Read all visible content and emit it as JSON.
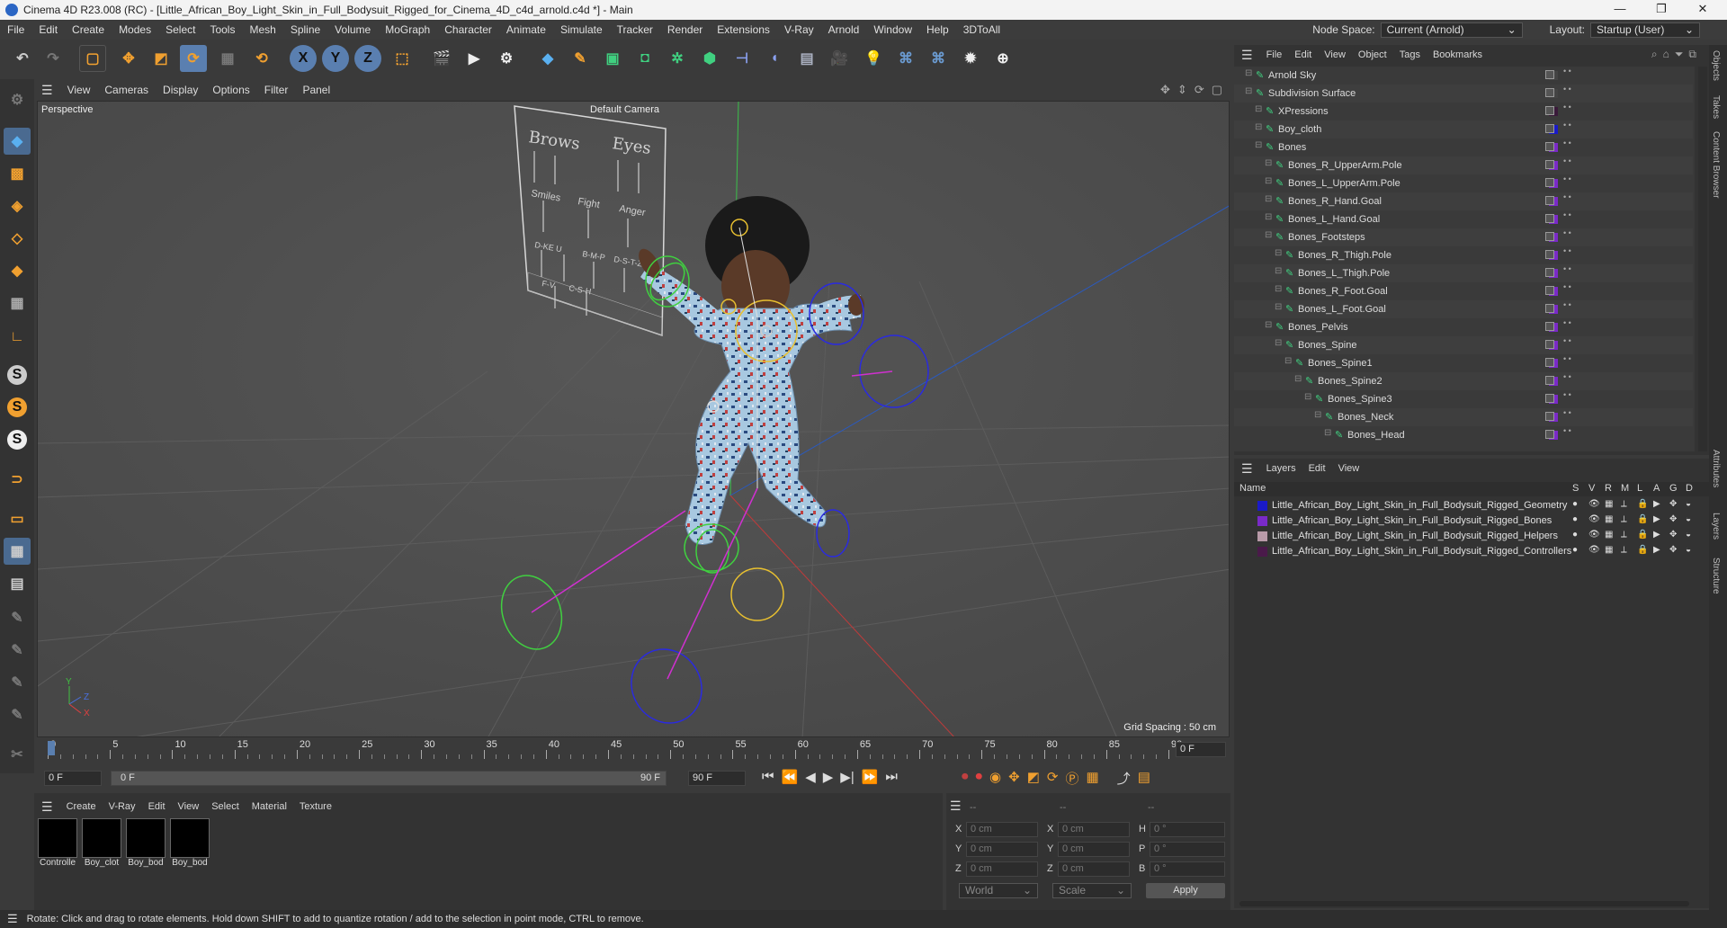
{
  "window": {
    "title": "Cinema 4D R23.008 (RC) - [Little_African_Boy_Light_Skin_in_Full_Bodysuit_Rigged_for_Cinema_4D_c4d_arnold.c4d *] - Main",
    "controls": [
      "—",
      "❐",
      "✕"
    ]
  },
  "menu": [
    "File",
    "Edit",
    "Create",
    "Modes",
    "Select",
    "Tools",
    "Mesh",
    "Spline",
    "Volume",
    "MoGraph",
    "Character",
    "Animate",
    "Simulate",
    "Tracker",
    "Render",
    "Extensions",
    "V-Ray",
    "Arnold",
    "Window",
    "Help",
    "3DToAll"
  ],
  "nodespace": {
    "label": "Node Space:",
    "value": "Current (Arnold)",
    "layout_label": "Layout:",
    "layout_value": "Startup (User)"
  },
  "viewport_menu": [
    "View",
    "Cameras",
    "Display",
    "Options",
    "Filter",
    "Panel"
  ],
  "viewport": {
    "name": "Perspective",
    "camera": "Default Camera",
    "grid_spacing": "Grid Spacing : 50 cm",
    "board_labels": {
      "brows": "Brows",
      "eyes": "Eyes",
      "smiles": "Smiles",
      "fight": "Fight",
      "anger": "Anger",
      "row1": "D-KE U",
      "row2": "B-M-P",
      "row3": "D-S-T-Z",
      "row4": "F-V",
      "row5": "C-S-H"
    },
    "axis": {
      "y": "Y",
      "z": "Z",
      "x": "X"
    }
  },
  "timeline": {
    "ticks": [
      "0",
      "5",
      "10",
      "15",
      "20",
      "25",
      "30",
      "35",
      "40",
      "45",
      "50",
      "55",
      "60",
      "65",
      "70",
      "75",
      "80",
      "85",
      "90"
    ],
    "current_frame": "0 F",
    "start": "0 F",
    "range_start": "0 F",
    "range_end": "90 F",
    "end": "90 F"
  },
  "materials_menu": [
    "Create",
    "V-Ray",
    "Edit",
    "View",
    "Select",
    "Material",
    "Texture"
  ],
  "materials": [
    "Controlle",
    "Boy_clot",
    "Boy_bod",
    "Boy_bod"
  ],
  "coords": {
    "header": [
      "--",
      "--",
      "--"
    ],
    "rows": [
      {
        "a": "X",
        "av": "0 cm",
        "b": "X",
        "bv": "0 cm",
        "c": "H",
        "cv": "0 °"
      },
      {
        "a": "Y",
        "av": "0 cm",
        "b": "Y",
        "bv": "0 cm",
        "c": "P",
        "cv": "0 °"
      },
      {
        "a": "Z",
        "av": "0 cm",
        "b": "Z",
        "bv": "0 cm",
        "c": "B",
        "cv": "0 °"
      }
    ],
    "mode1": "World",
    "mode2": "Scale",
    "apply": "Apply"
  },
  "status": "Rotate: Click and drag to rotate elements. Hold down SHIFT to add to quantize rotation / add to the selection in point mode, CTRL to remove.",
  "objects_menu": [
    "File",
    "Edit",
    "View",
    "Object",
    "Tags",
    "Bookmarks"
  ],
  "objects": [
    {
      "name": "Arnold Sky",
      "indent": 0,
      "color": "#444"
    },
    {
      "name": "Subdivision Surface",
      "indent": 0,
      "color": "#444"
    },
    {
      "name": "XPressions",
      "indent": 1,
      "color": "#3a1a3a"
    },
    {
      "name": "Boy_cloth",
      "indent": 1,
      "color": "#1a1ac8"
    },
    {
      "name": "Bones",
      "indent": 1,
      "color": "#7a2ac8"
    },
    {
      "name": "Bones_R_UpperArm.Pole",
      "indent": 2,
      "color": "#7a2ac8"
    },
    {
      "name": "Bones_L_UpperArm.Pole",
      "indent": 2,
      "color": "#7a2ac8"
    },
    {
      "name": "Bones_R_Hand.Goal",
      "indent": 2,
      "color": "#7a2ac8"
    },
    {
      "name": "Bones_L_Hand.Goal",
      "indent": 2,
      "color": "#7a2ac8"
    },
    {
      "name": "Bones_Footsteps",
      "indent": 2,
      "color": "#7a2ac8"
    },
    {
      "name": "Bones_R_Thigh.Pole",
      "indent": 3,
      "color": "#7a2ac8"
    },
    {
      "name": "Bones_L_Thigh.Pole",
      "indent": 3,
      "color": "#7a2ac8"
    },
    {
      "name": "Bones_R_Foot.Goal",
      "indent": 3,
      "color": "#7a2ac8"
    },
    {
      "name": "Bones_L_Foot.Goal",
      "indent": 3,
      "color": "#7a2ac8"
    },
    {
      "name": "Bones_Pelvis",
      "indent": 2,
      "color": "#7a2ac8"
    },
    {
      "name": "Bones_Spine",
      "indent": 3,
      "color": "#7a2ac8"
    },
    {
      "name": "Bones_Spine1",
      "indent": 4,
      "color": "#7a2ac8"
    },
    {
      "name": "Bones_Spine2",
      "indent": 5,
      "color": "#7a2ac8"
    },
    {
      "name": "Bones_Spine3",
      "indent": 6,
      "color": "#7a2ac8"
    },
    {
      "name": "Bones_Neck",
      "indent": 7,
      "color": "#7a2ac8"
    },
    {
      "name": "Bones_Head",
      "indent": 8,
      "color": "#7a2ac8"
    }
  ],
  "layers_menu": [
    "Layers",
    "Edit",
    "View"
  ],
  "layers_header": {
    "name": "Name",
    "cols": [
      "S",
      "V",
      "R",
      "M",
      "L",
      "A",
      "G",
      "D"
    ]
  },
  "layers": [
    {
      "name": "Little_African_Boy_Light_Skin_in_Full_Bodysuit_Rigged_Geometry",
      "color": "#1a1ac8"
    },
    {
      "name": "Little_African_Boy_Light_Skin_in_Full_Bodysuit_Rigged_Bones",
      "color": "#7a2ac8"
    },
    {
      "name": "Little_African_Boy_Light_Skin_in_Full_Bodysuit_Rigged_Helpers",
      "color": "#b89aa8"
    },
    {
      "name": "Little_African_Boy_Light_Skin_in_Full_Bodysuit_Rigged_Controllers",
      "color": "#4a1a4a"
    }
  ],
  "side_tabs": [
    "Objects",
    "Takes",
    "Content Browser",
    "Attributes",
    "Layers",
    "Structure"
  ]
}
